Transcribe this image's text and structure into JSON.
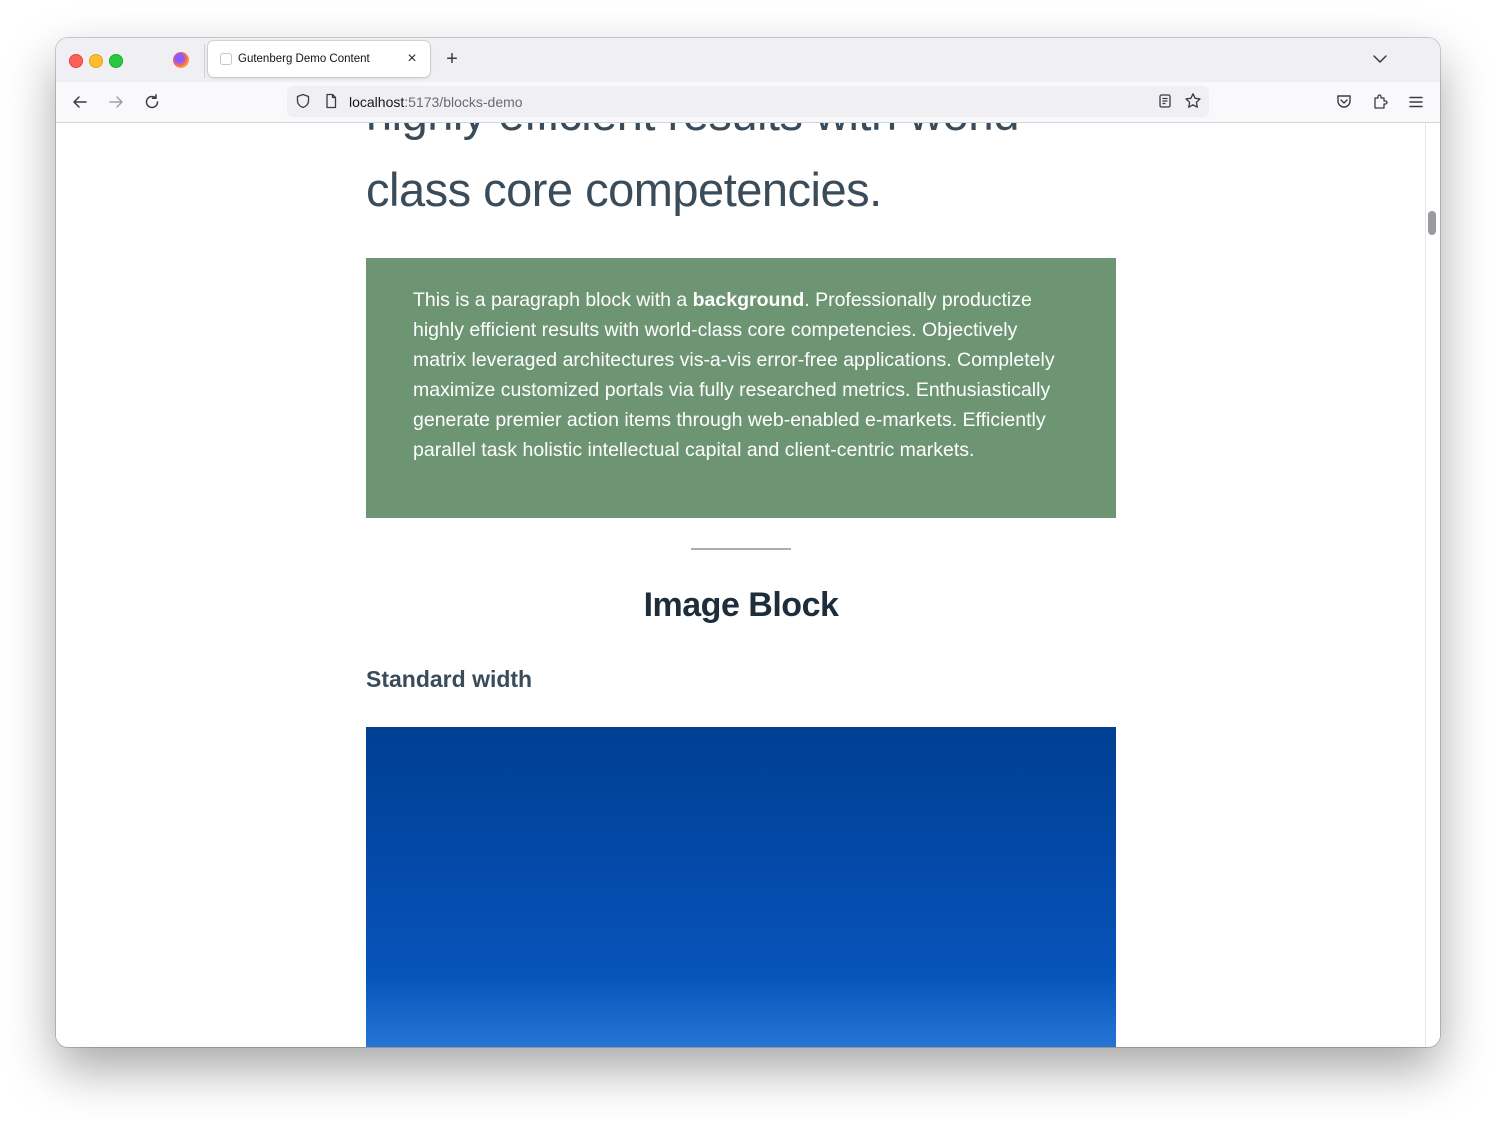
{
  "browser": {
    "tab_title": "Gutenberg Demo Content",
    "url_host": "localhost",
    "url_path": ":5173/blocks-demo",
    "new_tab_symbol": "+",
    "close_symbol": "×"
  },
  "page": {
    "heading_partial_line": "highly efficient results with world",
    "heading_line2": "class core competencies.",
    "bg_paragraph_prefix": "This is a paragraph block with a ",
    "bg_paragraph_bold": "background",
    "bg_paragraph_rest": ". Professionally productize highly efficient results with world-class core competencies. Objectively matrix leveraged architectures vis-a-vis error-free applications. Completely maximize customized portals via fully researched metrics. Enthusiastically generate premier action items through web-enabled e-markets. Efficiently parallel task holistic intellectual capital and client-centric markets.",
    "section_heading": "Image Block",
    "sub_heading": "Standard width"
  },
  "colors": {
    "paragraph_background": "#6d9573",
    "heading_text": "#3a4b5a",
    "image_top": "#003f92",
    "image_bottom": "#2a79d9"
  },
  "icons": [
    "firefox-icon",
    "back-arrow-icon",
    "forward-arrow-icon",
    "reload-icon",
    "shield-icon",
    "page-icon",
    "reader-view-icon",
    "bookmark-star-icon",
    "pocket-icon",
    "extensions-icon",
    "menu-icon",
    "chevron-down-icon"
  ]
}
